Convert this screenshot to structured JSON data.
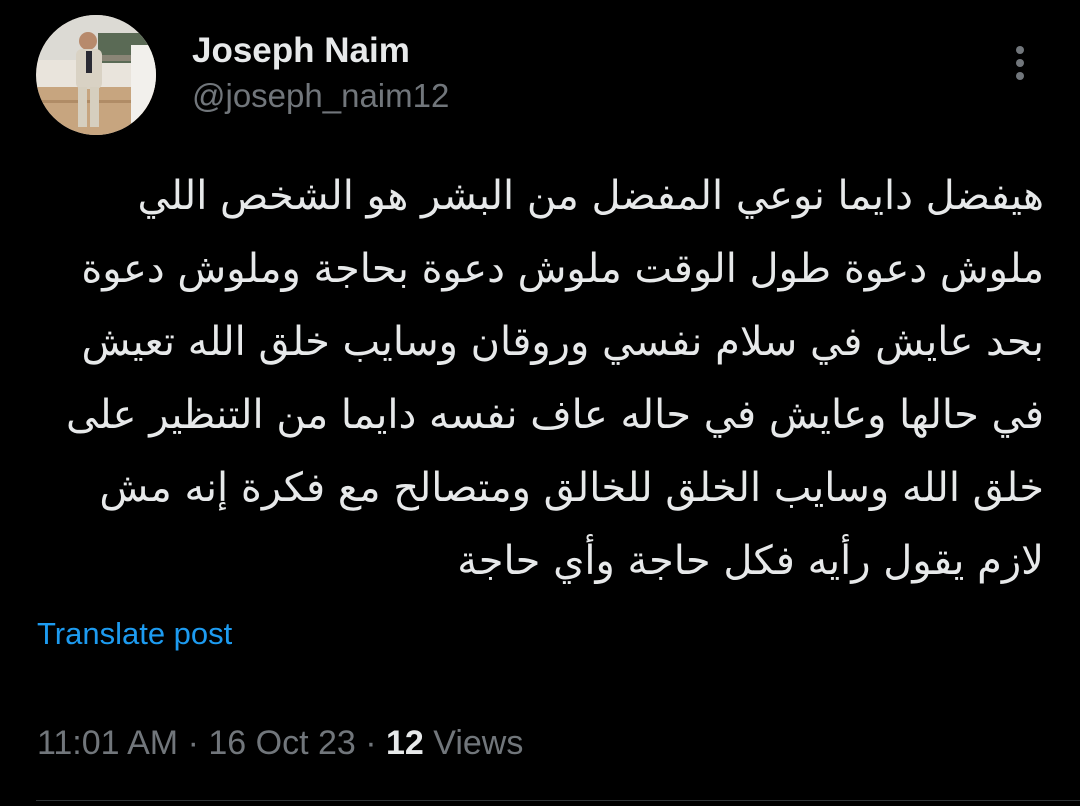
{
  "author": {
    "display_name": "Joseph Naim",
    "handle": "@joseph_naim12",
    "avatar": "profile-photo"
  },
  "menu": {
    "icon": "more-vertical-icon"
  },
  "post": {
    "direction": "rtl",
    "lines": [
      "هيفضل دايما نوعي المفضل من البشر هو الشخص اللي",
      "ملوش دعوة طول الوقت ملوش دعوة بحاجة وملوش دعوة",
      "بحد عايش في سلام نفسي وروقان وسايب خلق الله تعيش",
      "في حالها وعايش في حاله عاف نفسه دايما من التنظير على",
      "خلق الله وسايب الخلق للخالق ومتصالح مع فكرة إنه مش",
      "لازم يقول رأيه فكل حاجة وأي حاجة"
    ]
  },
  "translate_label": "Translate post",
  "meta": {
    "time": "11:01 AM",
    "separator": " · ",
    "date": "16 Oct 23",
    "views_count": "12",
    "views_label": " Views"
  },
  "colors": {
    "background": "#000000",
    "primary_text": "#e7e9ea",
    "secondary_text": "#71767b",
    "link": "#1d9bf0",
    "divider": "#2f3336"
  }
}
